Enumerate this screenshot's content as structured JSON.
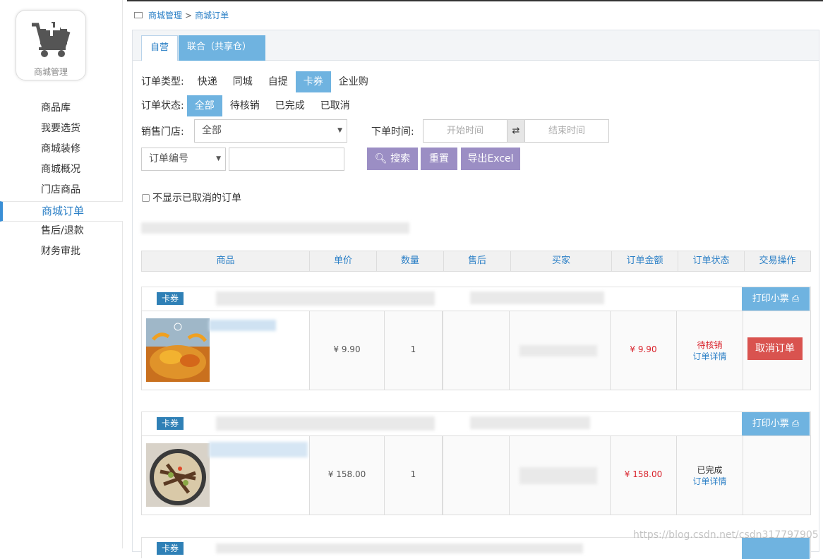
{
  "sidebar": {
    "logo_label": "商城管理",
    "items": [
      {
        "label": "商品库"
      },
      {
        "label": "我要选货"
      },
      {
        "label": "商城装修"
      },
      {
        "label": "商城概况"
      },
      {
        "label": "门店商品"
      },
      {
        "label": "商城订单",
        "active": true
      },
      {
        "label": "售后/退款"
      },
      {
        "label": "财务审批"
      }
    ]
  },
  "breadcrumb": {
    "root": "商城管理",
    "sep": ">",
    "current": "商城订单"
  },
  "tabs": [
    {
      "label": "自营",
      "active": true
    },
    {
      "label": "联合（共享仓）"
    }
  ],
  "filters": {
    "order_type_label": "订单类型:",
    "order_types": [
      "快递",
      "同城",
      "自提",
      "卡券",
      "企业购"
    ],
    "order_type_selected": "卡券",
    "order_status_label": "订单状态:",
    "order_statuses": [
      "全部",
      "待核销",
      "已完成",
      "已取消"
    ],
    "order_status_selected": "全部",
    "store_label": "销售门店:",
    "store_value": "全部",
    "time_label": "下单时间:",
    "start_placeholder": "开始时间",
    "end_placeholder": "结束时间",
    "swap_icon": "⇄",
    "field_select": "订单编号",
    "search": "搜索",
    "reset": "重置",
    "export": "导出Excel",
    "hide_cancelled": "不显示已取消的订单"
  },
  "table": {
    "headers": [
      "商品",
      "单价",
      "数量",
      "售后",
      "买家",
      "订单金额",
      "订单状态",
      "交易操作"
    ]
  },
  "orders": [
    {
      "tag": "卡券",
      "print": "打印小票",
      "price": "¥ 9.90",
      "qty": "1",
      "amount": "¥ 9.90",
      "status": "待核销",
      "status_color": "#d9232c",
      "detail": "订单详情",
      "action": "取消订单"
    },
    {
      "tag": "卡券",
      "print": "打印小票",
      "price": "¥ 158.00",
      "qty": "1",
      "amount": "¥ 158.00",
      "status": "已完成",
      "status_color": "#333333",
      "detail": "订单详情",
      "action": ""
    },
    {
      "tag": "卡券"
    }
  ],
  "watermark": "https://blog.csdn.net/csdn317797905"
}
